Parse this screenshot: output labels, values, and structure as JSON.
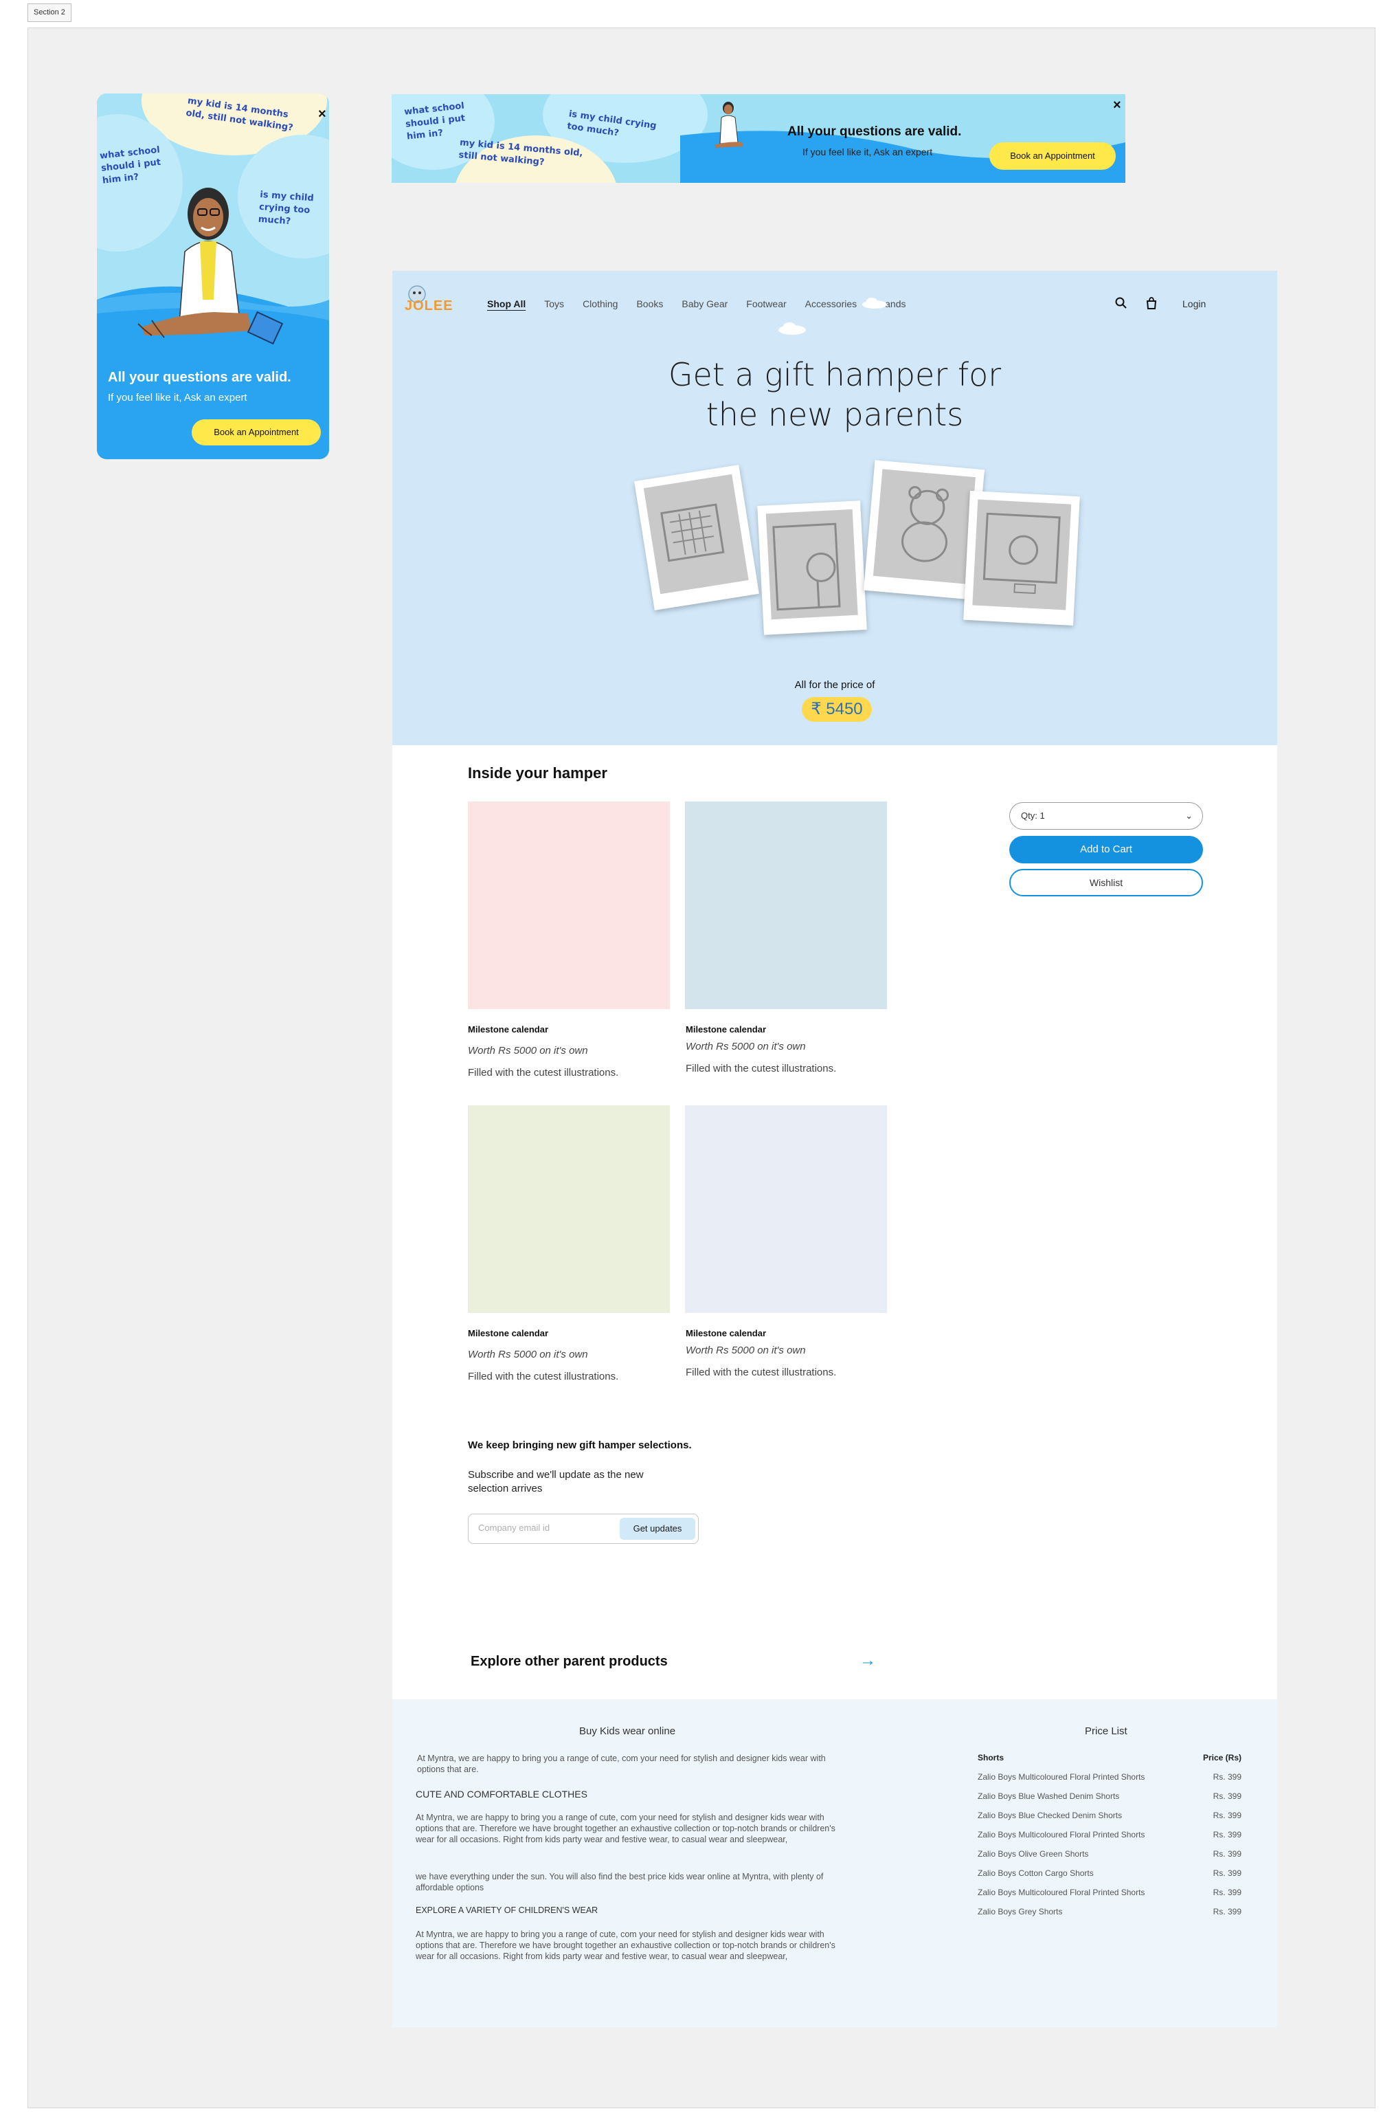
{
  "section_tag": "Section 2",
  "ad_vertical": {
    "bubble_walking": "my kid is 14 months old, still not walking?",
    "bubble_school": "what school should i put him in?",
    "bubble_crying": "is my child crying too much?",
    "close": "×",
    "title": "All your questions are valid.",
    "subtitle": "If you feel like it, Ask an expert",
    "button": "Book an Appointment"
  },
  "ad_horizontal": {
    "bubble_school": "what school should i put him in?",
    "bubble_walking": "my kid is 14 months old, still not walking?",
    "bubble_crying": "is my child crying too much?",
    "close": "×",
    "title": "All your questions are valid.",
    "subtitle": "If you feel like it, Ask an expert",
    "button": "Book an Appointment"
  },
  "header": {
    "logo": "JOLEE",
    "nav": [
      "Shop All",
      "Toys",
      "Clothing",
      "Books",
      "Baby Gear",
      "Footwear",
      "Accessories",
      "Brands"
    ],
    "login": "Login"
  },
  "hero": {
    "title_line1": "Get a gift hamper for",
    "title_line2": "the new parents",
    "price_label": "All for the price of",
    "price": "₹ 5450"
  },
  "hamper": {
    "title": "Inside your hamper",
    "cards": [
      {
        "name": "Milestone calendar",
        "worth": "Worth Rs 5000 on it's own",
        "desc": "Filled with the cutest illustrations.",
        "color": "#fde4e4"
      },
      {
        "name": "Milestone calendar",
        "worth": "Worth Rs 5000 on it's own",
        "desc": "Filled with the cutest illustrations.",
        "color": "#d3e4ed"
      },
      {
        "name": "Milestone calendar",
        "worth": "Worth Rs 5000 on it's own",
        "desc": "Filled with the cutest illustrations.",
        "color": "#ebf0dc"
      },
      {
        "name": "Milestone calendar",
        "worth": "Worth Rs 5000 on it's own",
        "desc": "Filled with the cutest illustrations.",
        "color": "#e9edf6"
      }
    ]
  },
  "purchase": {
    "qty": "Qty: 1",
    "add_to_cart": "Add to Cart",
    "wishlist": "Wishlist"
  },
  "subscribe": {
    "title": "We keep bringing new gift hamper selections.",
    "text": "Subscribe and we'll update as the new selection arrives",
    "placeholder": "Company email id",
    "button": "Get updates"
  },
  "explore": {
    "label": "Explore other parent products"
  },
  "footer": {
    "left_title": "Buy Kids wear online",
    "intro": "At Myntra, we are happy to bring you a range of cute, com your need for stylish and designer kids wear with options that are.",
    "heading1": "CUTE AND COMFORTABLE CLOTHES",
    "para1": "At Myntra, we are happy to bring you a range of cute, com your need for stylish and designer kids wear with options that are. Therefore we have brought together an exhaustive collection or top-notch brands or children's wear for all occasions. Right from kids party wear and festive wear, to casual wear and sleepwear,",
    "para2": "we have everything under the sun. You will also find the best price kids wear online at Myntra, with plenty of affordable options",
    "heading2": "EXPLORE A VARIETY OF CHILDREN'S WEAR",
    "para3": "At Myntra, we are happy to bring you a range of cute, com your need for stylish and designer kids wear with options that are. Therefore we have brought together an exhaustive collection or top-notch brands or children's wear for all occasions. Right from kids party wear and festive wear, to casual wear and sleepwear,",
    "price_list_title": "Price List",
    "col_item": "Shorts",
    "col_price": "Price (Rs)",
    "rows": [
      {
        "item": "Zalio Boys Multicoloured Floral Printed Shorts",
        "price": "Rs. 399"
      },
      {
        "item": "Zalio Boys Blue Washed Denim Shorts",
        "price": "Rs. 399"
      },
      {
        "item": "Zalio Boys Blue Checked Denim Shorts",
        "price": "Rs. 399"
      },
      {
        "item": "Zalio Boys Multicoloured Floral Printed Shorts",
        "price": "Rs. 399"
      },
      {
        "item": "Zalio Boys Olive Green Shorts",
        "price": "Rs. 399"
      },
      {
        "item": "Zalio Boys Cotton Cargo Shorts",
        "price": "Rs. 399"
      },
      {
        "item": "Zalio Boys Multicoloured Floral Printed Shorts",
        "price": "Rs. 399"
      },
      {
        "item": "Zalio Boys Grey Shorts",
        "price": "Rs. 399"
      }
    ]
  },
  "colors": {
    "accent_blue": "#1592df",
    "hero_bg": "#d2e8f9",
    "ad_blue": "#2aa3f0",
    "yellow": "#ffe84a"
  }
}
